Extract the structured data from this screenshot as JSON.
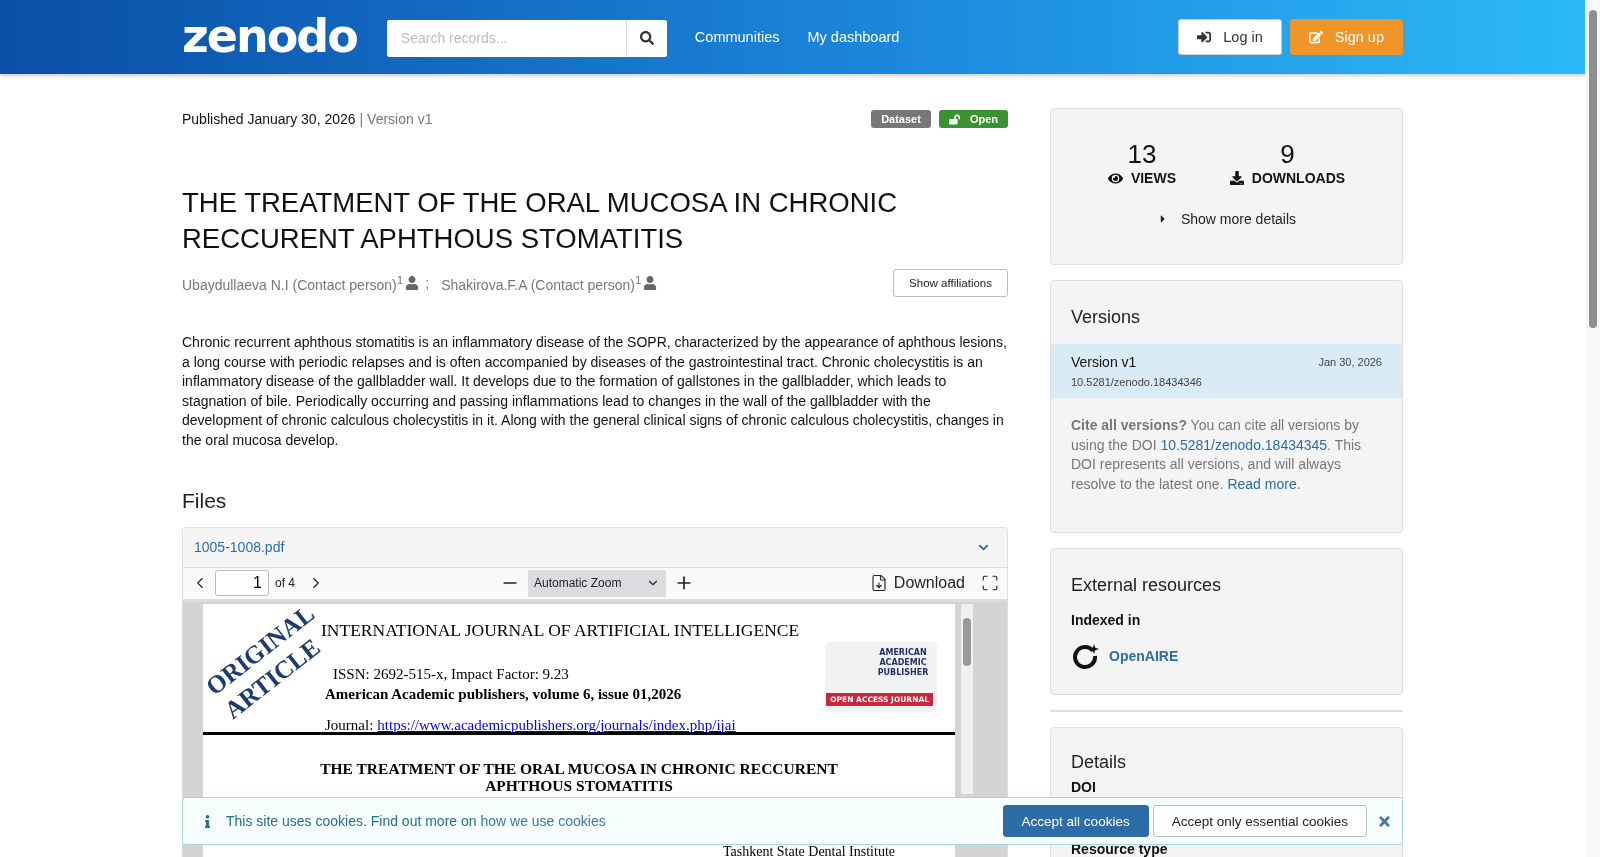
{
  "header": {
    "logo": "zenodo",
    "search": {
      "placeholder": "Search records..."
    },
    "nav": [
      {
        "label": "Communities"
      },
      {
        "label": "My dashboard"
      }
    ],
    "login": "Log in",
    "signup": "Sign up"
  },
  "record": {
    "published": "Published January 30, 2026",
    "version": "| Version v1",
    "badges": [
      {
        "label": "Dataset",
        "kind": "type"
      },
      {
        "label": "Open",
        "kind": "access"
      }
    ],
    "title": "THE TREATMENT OF THE ORAL MUCOSA IN CHRONIC RECCURENT APHTHOUS STOMATITIS",
    "creators": [
      {
        "name": "Ubaydullaeva N.I (Contact person)",
        "sup": "1"
      },
      {
        "name": "Shakirova.F.A (Contact person)",
        "sup": "1"
      }
    ],
    "separator": ";",
    "affiliations_button": "Show affiliations",
    "abstract": "Chronic recurrent aphthous stomatitis is an inflammatory disease of the SOPR, characterized by the appearance of aphthous lesions, a long course with periodic relapses and is often accompanied by diseases of the gastrointestinal tract.  Chronic cholecystitis is an inflammatory disease of the gallbladder wall. It develops due to the formation of gallstones in the gallbladder, which leads to stagnation of bile. Periodically occurring and passing inflammations lead to changes in the wall of the gallbladder with the development of chronic calculous cholecystitis in it. Along with the general clinical signs of chronic calculous cholecystitis, changes in the oral mucosa develop."
  },
  "files": {
    "heading": "Files",
    "file_name": "1005-1008.pdf",
    "viewer": {
      "page": "1",
      "page_count": "of 4",
      "zoom": "Automatic Zoom",
      "download": "Download"
    },
    "document": {
      "stamp": "ORIGINAL ARTICLE",
      "journal": "INTERNATIONAL JOURNAL OF ARTIFICIAL INTELLIGENCE",
      "issn": "ISSN: 2692-515-x, Impact Factor: 9.23",
      "publisher_line": "American Academic publishers, volume 6, issue 01,2026",
      "journal_label": "Journal:",
      "journal_url": "https://www.academicpublishers.org/journals/index.php/ijai",
      "publisher_logo": "AMERICAN ACADEMIC PUBLISHER",
      "logo_ribbon": "OPEN ACCESS JOURNAL",
      "paper_title": "THE TREATMENT OF THE ORAL MUCOSA IN CHRONIC RECCURENT APHTHOUS STOMATITIS",
      "affiliation": "Tashkent State Dental Institute"
    }
  },
  "stats": [
    {
      "value": "13",
      "label": "VIEWS",
      "kind": "views"
    },
    {
      "value": "9",
      "label": "DOWNLOADS",
      "kind": "downloads"
    }
  ],
  "more_details": "Show more details",
  "versions": {
    "heading": "Versions",
    "items": [
      {
        "name": "Version v1",
        "date": "Jan 30, 2026",
        "doi": "10.5281/zenodo.18434346",
        "selected": true
      }
    ],
    "cite": {
      "lead": "Cite all versions?",
      "before": " You can cite all versions by using the DOI ",
      "doi": "10.5281/zenodo.18434345",
      "after": ". This DOI represents all versions, and will always resolve to the latest one. ",
      "read_more": "Read more",
      "end": "."
    }
  },
  "external": {
    "heading": "External resources",
    "subheading": "Indexed in",
    "links": [
      {
        "label": "OpenAIRE"
      }
    ]
  },
  "details": {
    "heading": "Details",
    "fields": [
      {
        "label": "DOI"
      },
      {
        "label": "Resource type"
      }
    ]
  },
  "cookie_banner": {
    "text": "This site uses cookies. Find out more on ",
    "link": "how we use cookies",
    "accept_all": "Accept all cookies",
    "accept_essential": "Accept only essential cookies"
  }
}
